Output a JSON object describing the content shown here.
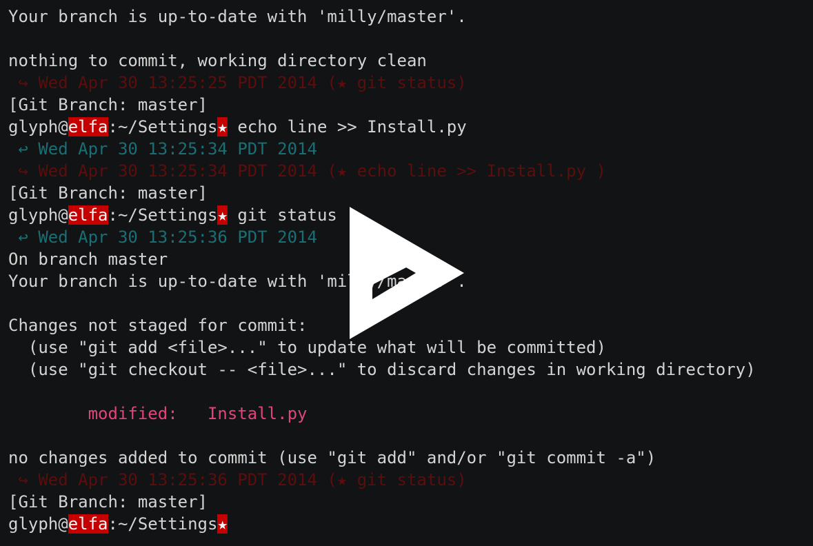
{
  "terminal": {
    "lines": [
      {
        "type": "text",
        "text": "Your branch is up-to-date with 'milly/master'."
      },
      {
        "type": "blank"
      },
      {
        "type": "text",
        "text": "nothing to commit, working directory clean"
      },
      {
        "type": "done",
        "text": " ↪ Wed Apr 30 13:25:25 PDT 2014 (★ git status)"
      },
      {
        "type": "text",
        "text": "[Git Branch: master]"
      },
      {
        "type": "prompt",
        "user": "glyph@",
        "host": "elfa",
        "path": ":~/Settings",
        "star": "★",
        "command": " echo line >> Install.py"
      },
      {
        "type": "echo",
        "text": " ↩ Wed Apr 30 13:25:34 PDT 2014"
      },
      {
        "type": "done",
        "text": " ↪ Wed Apr 30 13:25:34 PDT 2014 (★ echo line >> Install.py )"
      },
      {
        "type": "text",
        "text": "[Git Branch: master]"
      },
      {
        "type": "prompt",
        "user": "glyph@",
        "host": "elfa",
        "path": ":~/Settings",
        "star": "★",
        "command": " git status"
      },
      {
        "type": "echo",
        "text": " ↩ Wed Apr 30 13:25:36 PDT 2014"
      },
      {
        "type": "text",
        "text": "On branch master"
      },
      {
        "type": "text",
        "text": "Your branch is up-to-date with 'milly/master'."
      },
      {
        "type": "blank"
      },
      {
        "type": "text",
        "text": "Changes not staged for commit:"
      },
      {
        "type": "text",
        "text": "  (use \"git add <file>...\" to update what will be committed)"
      },
      {
        "type": "text",
        "text": "  (use \"git checkout -- <file>...\" to discard changes in working directory)"
      },
      {
        "type": "blank"
      },
      {
        "type": "modified",
        "text": "        modified:   Install.py"
      },
      {
        "type": "blank"
      },
      {
        "type": "text",
        "text": "no changes added to commit (use \"git add\" and/or \"git commit -a\")"
      },
      {
        "type": "done",
        "text": " ↪ Wed Apr 30 13:25:36 PDT 2014 (★ git status)"
      },
      {
        "type": "text",
        "text": "[Git Branch: master]"
      },
      {
        "type": "prompt",
        "user": "glyph@",
        "host": "elfa",
        "path": ":~/Settings",
        "star": "★",
        "command": ""
      }
    ]
  },
  "overlay": {
    "icon": "play-icon",
    "color": "#ffffff"
  },
  "colors": {
    "background": "#121314",
    "text": "#d4d4d4",
    "timestamp_echo": "#1a6f74",
    "timestamp_done": "#5c0d0d",
    "modified": "#e0457a",
    "prompt_highlight": "#c40000"
  }
}
